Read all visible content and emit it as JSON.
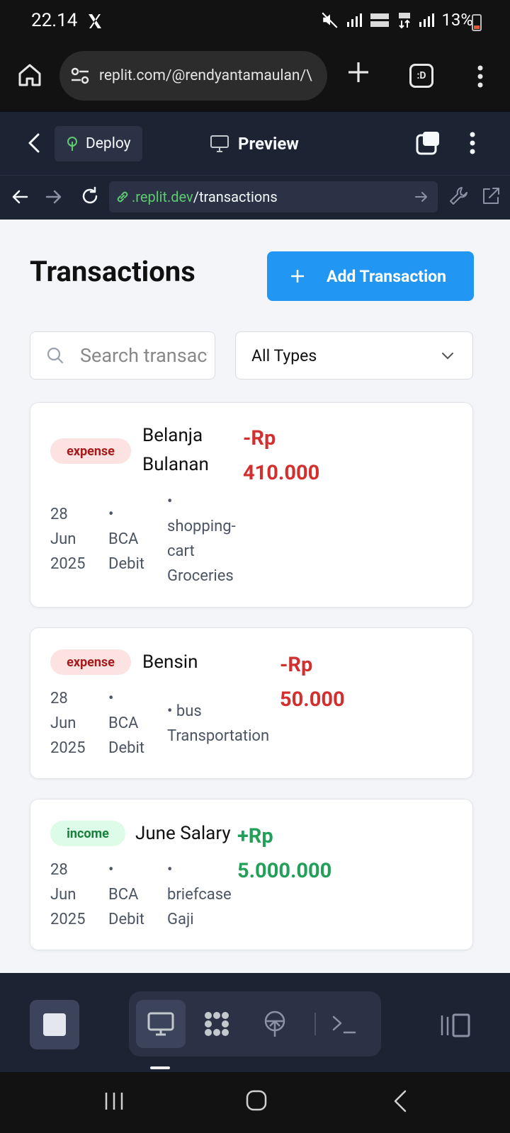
{
  "status_bar": {
    "time": "22.14",
    "battery": "13%"
  },
  "browser": {
    "url": "replit.com/@rendyantamaulan/\\",
    "tabs_label": ":D"
  },
  "replit_header": {
    "deploy_label": "Deploy",
    "preview_label": "Preview"
  },
  "address_bar": {
    "domain": ".replit.dev",
    "path": "/transactions"
  },
  "page": {
    "title": "Transactions",
    "add_button_label": "Add Transaction",
    "search_placeholder": "Search transactions...",
    "type_filter": "All Types"
  },
  "transactions": [
    {
      "type": "expense",
      "name_line1": "Belanja",
      "name_line2": "Bulanan",
      "amount_line1": "-Rp",
      "amount_line2": "410.000",
      "date_day": "28",
      "date_month": "Jun",
      "date_year": "2025",
      "account_line1": "BCA",
      "account_line2": "Debit",
      "category_icon_line1": "shopping-",
      "category_icon_line2": "cart",
      "category_name": "Groceries"
    },
    {
      "type": "expense",
      "name": "Bensin",
      "amount_line1": "-Rp",
      "amount_line2": "50.000",
      "date_day": "28",
      "date_month": "Jun",
      "date_year": "2025",
      "account_line1": "BCA",
      "account_line2": "Debit",
      "category_icon": "bus",
      "category_name": "Transportation"
    },
    {
      "type": "income",
      "name": "June Salary",
      "amount_line1": "+Rp",
      "amount_line2": "5.000.000",
      "date_day": "28",
      "date_month": "Jun",
      "date_year": "2025",
      "account_line1": "BCA",
      "account_line2": "Debit",
      "category_icon": "briefcase",
      "category_name": "Gaji"
    }
  ],
  "colors": {
    "accent": "#2196f3",
    "expense": "#d32f2f",
    "income": "#22a05a",
    "replit_bg": "#1c2333"
  }
}
